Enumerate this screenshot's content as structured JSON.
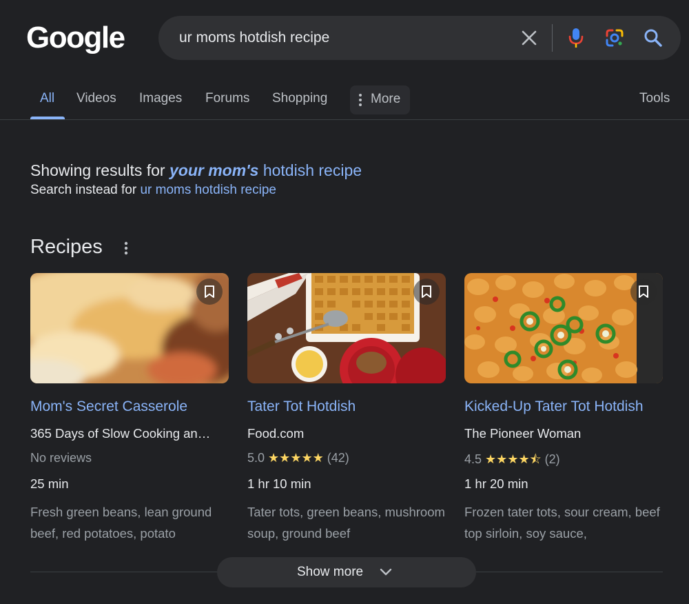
{
  "logo": "Google",
  "search": {
    "query": "ur moms hotdish recipe"
  },
  "tabs": [
    {
      "label": "All"
    },
    {
      "label": "Videos"
    },
    {
      "label": "Images"
    },
    {
      "label": "Forums"
    },
    {
      "label": "Shopping"
    }
  ],
  "more_label": "More",
  "tools_label": "Tools",
  "correction": {
    "prefix": "Showing results for ",
    "emphasized": "your mom's",
    "rest": " hotdish recipe",
    "instead_prefix": "Search instead for ",
    "instead_link": "ur moms hotdish recipe"
  },
  "recipes": {
    "title": "Recipes",
    "cards": [
      {
        "title": "Mom's Secret Casserole",
        "source": "365 Days of Slow Cooking an…",
        "rating_text": "No reviews",
        "rating": null,
        "stars": "",
        "reviews": "",
        "time": "25 min",
        "ingredients": "Fresh green beans, lean ground beef, red potatoes, potato"
      },
      {
        "title": "Tater Tot Hotdish",
        "source": "Food.com",
        "rating": "5.0",
        "stars": "★★★★★",
        "reviews": "(42)",
        "time": "1 hr 10 min",
        "ingredients": "Tater tots, green beans, mushroom soup, ground beef"
      },
      {
        "title": "Kicked-Up Tater Tot Hotdish",
        "source": "The Pioneer Woman",
        "rating": "4.5",
        "stars": "★★★★⯪",
        "reviews": "(2)",
        "time": "1 hr 20 min",
        "ingredients": "Frozen tater tots, sour cream, beef top sirloin, soy sauce,"
      }
    ]
  },
  "show_more": "Show more",
  "colors": {
    "background": "#202124",
    "link": "#8ab4f8",
    "text": "#e8eaed",
    "muted": "#9aa0a6",
    "star": "#fdd663"
  }
}
